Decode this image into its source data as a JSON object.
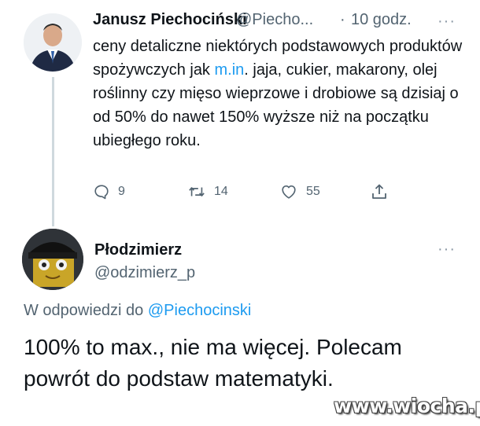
{
  "tweet1": {
    "name": "Janusz Piechociński",
    "handle": "@Piecho...",
    "separator": "·",
    "time": "10 godz.",
    "more": "···",
    "text_before": "ceny detaliczne niektórych podstawowych produktów spożywczych jak ",
    "mention": "m.in",
    "text_after": ". jaja, cukier, makarony, olej roślinny czy mięso wieprzowe i drobiowe są dzisiaj o od 50% do nawet 150% wyższe niż na początku ubiegłego roku.",
    "actions": {
      "replies": "9",
      "retweets": "14",
      "likes": "55"
    }
  },
  "tweet2": {
    "name": "Płodzimierz",
    "handle": "@odzimierz_p",
    "more": "···",
    "reply_prefix": "W odpowiedzi do ",
    "reply_mention": "@Piechocinski",
    "text": "100% to max., nie ma więcej. Polecam powrót do podstaw matematyki."
  },
  "watermark": "www.wiocha.pl",
  "icons": {
    "reply": "reply-icon",
    "retweet": "retweet-icon",
    "like": "heart-icon",
    "share": "share-icon"
  },
  "colors": {
    "text": "#0f1419",
    "secondary": "#536471",
    "link": "#1d9bf0",
    "thread_line": "#cfd9de"
  }
}
